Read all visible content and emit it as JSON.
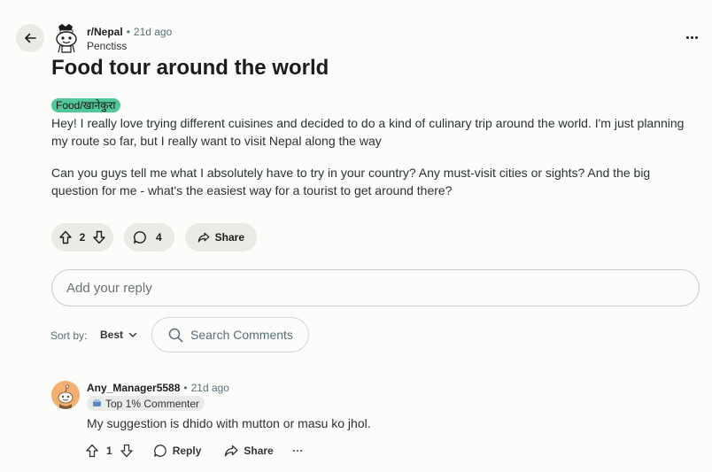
{
  "post": {
    "subreddit": "r/Nepal",
    "separator": "•",
    "age": "21d ago",
    "author": "Penctiss",
    "title": "Food tour around the world",
    "flair": "Food/खानेकुरा",
    "paragraphs": [
      "Hey! I really love trying different cuisines and decided to do a kind of culinary trip around the world. I'm just planning my route so far, but I really want to visit Nepal along the way",
      "Can you guys tell me what I absolutely have to try in your country? Any must-visit cities or sights? And the big question for me - what's the easiest way for a tourist to get around there?"
    ],
    "votes": "2",
    "comments": "4",
    "share_label": "Share"
  },
  "reply": {
    "placeholder": "Add your reply"
  },
  "sort": {
    "label": "Sort by:",
    "value": "Best"
  },
  "search": {
    "placeholder": "Search Comments"
  },
  "comment": {
    "author": "Any_Manager5588",
    "separator": "•",
    "age": "21d ago",
    "badge": "Top 1% Commenter",
    "text": "My suggestion is dhido with mutton or masu ko jhol.",
    "votes": "1",
    "reply_label": "Reply",
    "share_label": "Share"
  },
  "icons": {
    "back": "arrow-left-icon",
    "more": "ellipsis-icon",
    "upvote": "arrow-up-icon",
    "downvote": "arrow-down-icon",
    "comment": "speech-bubble-icon",
    "share": "share-arrow-icon",
    "search": "search-icon",
    "chevron": "chevron-down-icon",
    "badge": "trophy-icon"
  },
  "colors": {
    "flair_bg": "#52c79a",
    "pill_bg": "#e9ebe6",
    "avatar_comment": "#f3b071"
  }
}
